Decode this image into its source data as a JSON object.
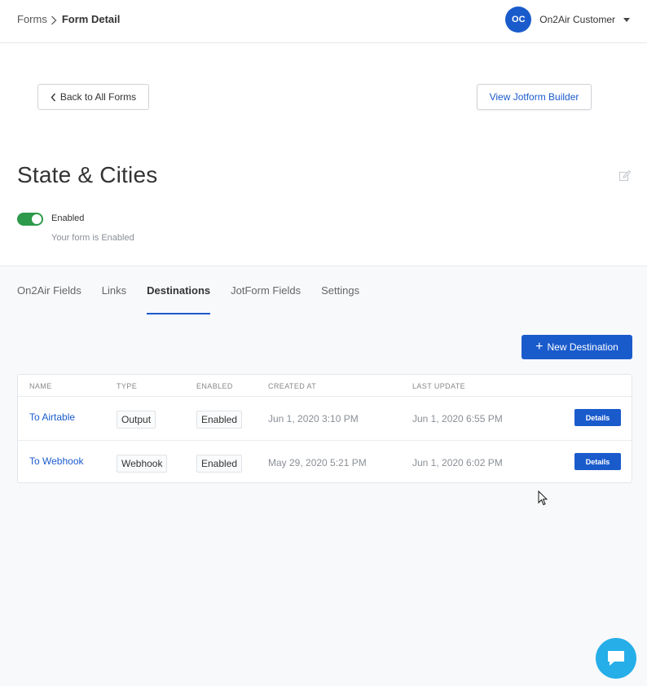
{
  "breadcrumb": {
    "parent": "Forms",
    "current": "Form Detail"
  },
  "user": {
    "initials": "OC",
    "name": "On2Air Customer"
  },
  "actions": {
    "back": "Back to All Forms",
    "builder": "View Jotform Builder",
    "new_destination": "New Destination"
  },
  "form": {
    "title": "State & Cities",
    "status_label": "Enabled",
    "status_sub": "Your form is Enabled",
    "enabled": true
  },
  "tabs": [
    {
      "label": "On2Air Fields"
    },
    {
      "label": "Links"
    },
    {
      "label": "Destinations",
      "active": true
    },
    {
      "label": "JotForm Fields"
    },
    {
      "label": "Settings"
    }
  ],
  "table": {
    "headers": [
      "NAME",
      "TYPE",
      "ENABLED",
      "CREATED AT",
      "LAST UPDATE"
    ],
    "rows": [
      {
        "name": "To Airtable",
        "type": "Output",
        "enabled": "Enabled",
        "created": "Jun 1, 2020 3:10 PM",
        "updated": "Jun 1, 2020 6:55 PM",
        "action": "Details"
      },
      {
        "name": "To Webhook",
        "type": "Webhook",
        "enabled": "Enabled",
        "created": "May 29, 2020 5:21 PM",
        "updated": "Jun 1, 2020 6:02 PM",
        "action": "Details"
      }
    ]
  },
  "colors": {
    "primary": "#1a5bcc",
    "toggle_on": "#2c9a4a",
    "chat": "#26aee8"
  }
}
